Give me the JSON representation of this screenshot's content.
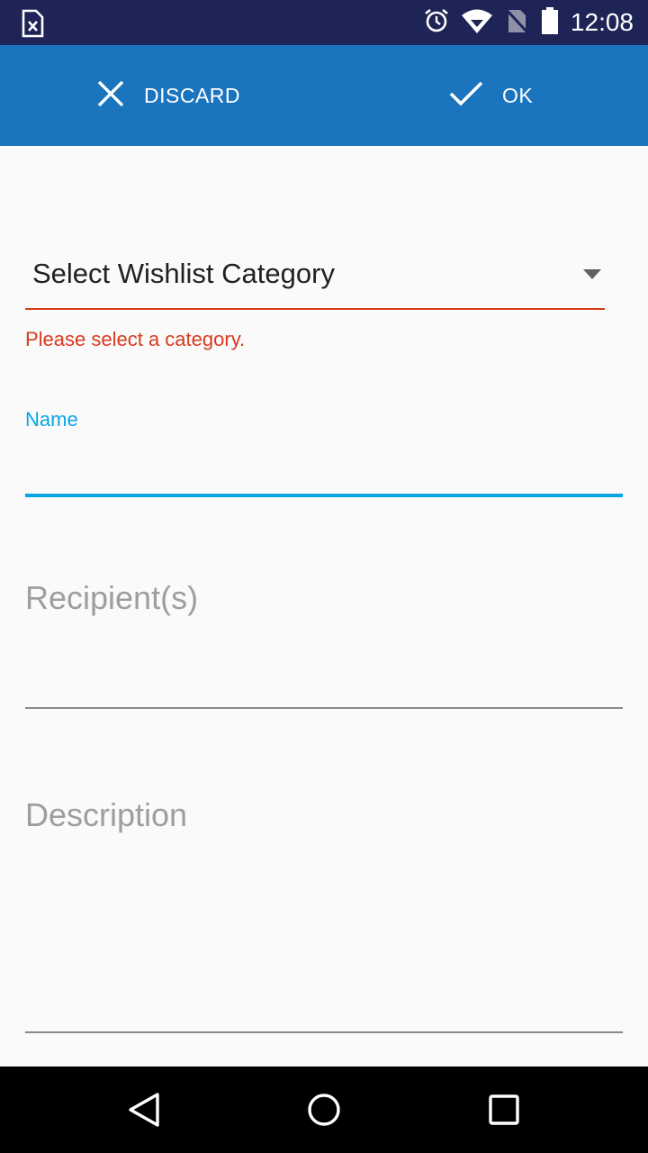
{
  "status_bar": {
    "time": "12:08",
    "icons": [
      "sim-error-icon",
      "alarm-icon",
      "wifi-icon",
      "no-sim-icon",
      "battery-icon"
    ]
  },
  "toolbar": {
    "discard_label": "DISCARD",
    "ok_label": "OK",
    "background": "#1A75BE"
  },
  "form": {
    "category_spinner": {
      "selected": "Select Wishlist Category",
      "error": "Please select a category."
    },
    "name": {
      "label": "Name",
      "value": ""
    },
    "recipients": {
      "placeholder": "Recipient(s)",
      "value": ""
    },
    "description": {
      "placeholder": "Description",
      "value": ""
    }
  },
  "nav_bar": {
    "buttons": [
      "back-icon",
      "home-icon",
      "recents-icon"
    ]
  },
  "colors": {
    "status_bar": "#1F2456",
    "accent": "#0AA5E8",
    "error": "#D83A1E",
    "hint": "#9E9E9E"
  }
}
